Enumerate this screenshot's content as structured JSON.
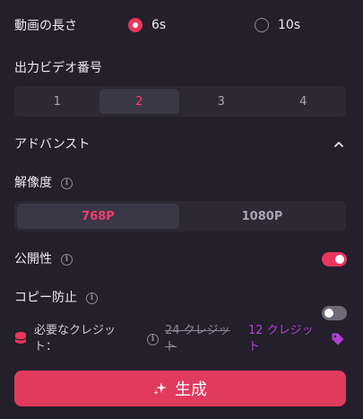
{
  "duration": {
    "label": "動画の長さ",
    "options": [
      {
        "label": "6s",
        "selected": true
      },
      {
        "label": "10s",
        "selected": false
      }
    ]
  },
  "output_video_number": {
    "label": "出力ビデオ番号",
    "options": [
      "1",
      "2",
      "3",
      "4"
    ],
    "selected": "2"
  },
  "advanced": {
    "label": "アドバンスト",
    "expanded": true,
    "icon": "chevron-up-icon"
  },
  "resolution": {
    "label": "解像度",
    "options": [
      "768P",
      "1080P"
    ],
    "selected": "768P"
  },
  "public": {
    "label": "公開性",
    "enabled": true
  },
  "copy_protection": {
    "label": "コピー防止",
    "enabled": false
  },
  "credits": {
    "label_line1": "必要なクレジッ",
    "label_line2": "ト：",
    "original_line1": "24 クレジッ",
    "original_line2": "ト",
    "discounted_line1": "12 クレジッ",
    "discounted_line2": "ト"
  },
  "generate_button": {
    "label": "生成",
    "icon": "sparkle-icon"
  },
  "colors": {
    "background": "#231f2b",
    "accent": "#e8365c",
    "discount": "#b63fd8"
  }
}
